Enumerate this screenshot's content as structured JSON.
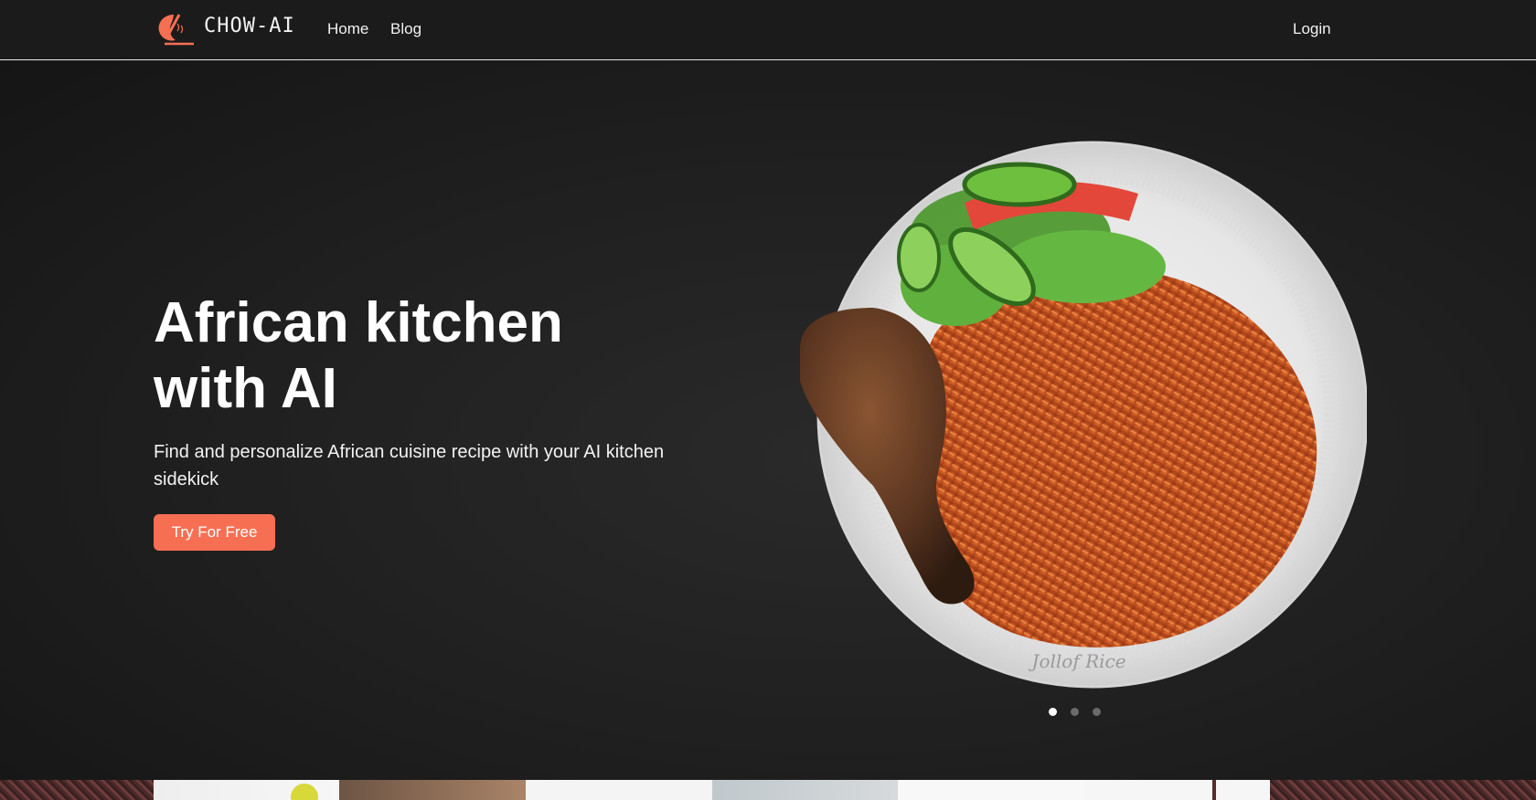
{
  "nav": {
    "brand": "CHOW-AI",
    "links": [
      {
        "label": "Home"
      },
      {
        "label": "Blog"
      }
    ],
    "login_label": "Login"
  },
  "hero": {
    "title_line1": "African kitchen",
    "title_line2": "with AI",
    "subtitle": "Find and personalize African cuisine recipe with your AI kitchen sidekick",
    "cta_label": "Try For Free",
    "carousel": {
      "caption": "Jollof Rice",
      "slide_count": 3,
      "active_slide": 1
    }
  },
  "colors": {
    "accent": "#f76f53",
    "background": "#1d1d1d",
    "text": "#ffffff"
  },
  "icons": {
    "logo": "chow-ai-logo-icon"
  }
}
